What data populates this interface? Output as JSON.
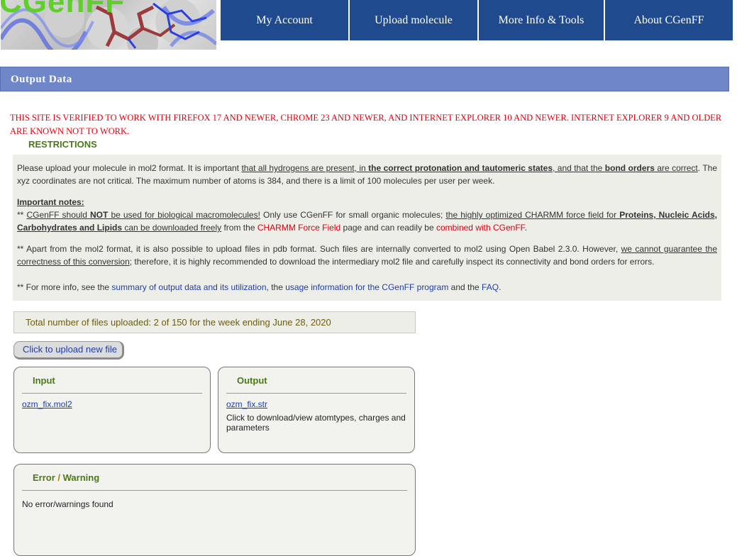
{
  "header": {
    "logo_text": "CGenFF",
    "nav": [
      "My Account",
      "Upload molecule",
      "More Info & Tools",
      "About CGenFF"
    ]
  },
  "titlebar": {
    "title": "Output Data"
  },
  "warning": "This site is verified to work with Firefox 17 and newer, Chrome 23 and newer, and Internet Explorer 10 and newer. Internet Explorer 9 and older are known not to work.",
  "restrictions": {
    "heading": "RESTRICTIONS",
    "p1": {
      "t1": "Please upload your molecule in mol2 format. It is important ",
      "u1": "that all hydrogens are present, in ",
      "b1": "the correct protonation and tautomeric states",
      "u2": ", and that the ",
      "b2": "bond orders",
      "u3": " are correct",
      "t2": ". The xyz coordinates are not critical. The maximum number of atoms is 384, and there is a limit of 100 molecules per user per week."
    },
    "notes_heading": "Important notes:",
    "p2": {
      "t1": "** ",
      "u1": "CGenFF should ",
      "b1": "NOT",
      "u2": " be used for biological macromolecules!",
      "t2": " Only use CGenFF for small organic molecules; ",
      "u3": "the highly optimized CHARMM force field for ",
      "b2": "Proteins, Nucleic Acids, Carbohydrates and Lipids",
      "u4": " can be downloaded freely",
      "t3": " from the ",
      "link1": "CHARMM Force Field",
      "t4": " page and can readily be ",
      "link2": "combined with CGenFF",
      "t5": "."
    },
    "p3": {
      "t1": "** Apart from the mol2 format, it is also possible to upload files in pdb format. Such files are internally converted to mol2 using Open Babel 2.3.0. However, ",
      "u1": "we cannot guarantee the correctness of this conversion",
      "t2": "; therefore, it is highly recommended to download the intermediary mol2 file and carefully inspect its connectivity and bond orders for errors."
    },
    "p4": {
      "t1": "** For more info, see the ",
      "link1": "summary of output data and its utilization",
      "t2": ", the ",
      "link2": "usage information for the CGenFF program",
      "t3": " and the ",
      "link3": "FAQ",
      "t4": "."
    }
  },
  "upload_count": "Total number of files uploaded: 2 of 150 for the week ending June 28, 2020",
  "upload_button": "Click to upload new file",
  "input_panel": {
    "title": "Input",
    "file": "ozm_fix.mol2"
  },
  "output_panel": {
    "title": "Output",
    "file": "ozm_fix.str",
    "description": "Click to download/view atomtypes, charges and parameters"
  },
  "error_panel": {
    "title_part1": "Error",
    "title_sep": " / ",
    "title_part2": "Warning",
    "text": "No error/warnings found"
  }
}
